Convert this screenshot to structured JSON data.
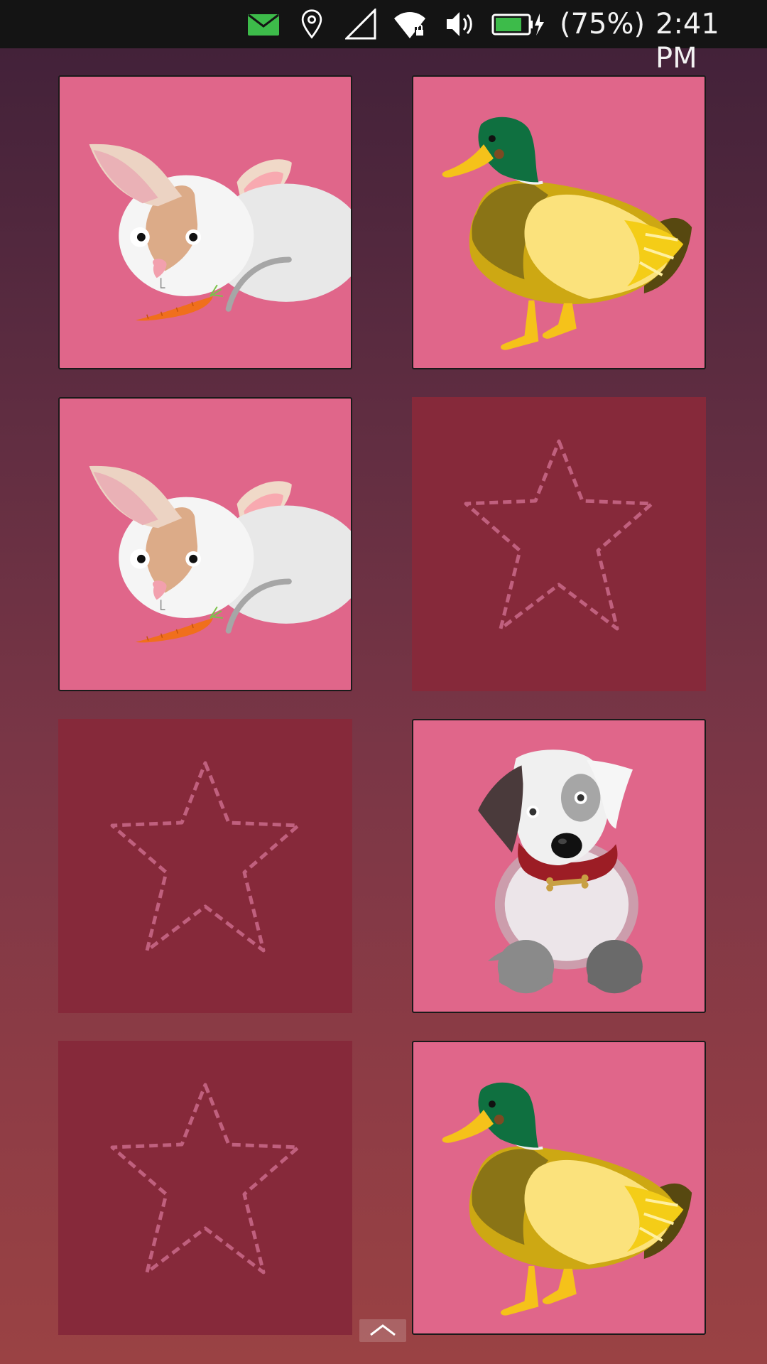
{
  "status_bar": {
    "battery_text": "(75%)",
    "time": "2:41 PM",
    "icons": [
      "mail-icon",
      "location-icon",
      "signal-icon",
      "wifi-lock-icon",
      "volume-icon",
      "battery-charging-icon"
    ],
    "mail_color": "#3dbb4a"
  },
  "board": {
    "columns": 2,
    "rows": 4,
    "cards": [
      {
        "animal": "rabbit",
        "state": "face-up"
      },
      {
        "animal": "duck",
        "state": "face-up"
      },
      {
        "animal": "rabbit",
        "state": "face-up"
      },
      {
        "animal": "hidden",
        "state": "face-down"
      },
      {
        "animal": "hidden",
        "state": "face-down"
      },
      {
        "animal": "dog",
        "state": "face-up"
      },
      {
        "animal": "hidden",
        "state": "face-down"
      },
      {
        "animal": "duck",
        "state": "face-up"
      }
    ],
    "colors": {
      "face_up_bg": "#e0668a",
      "face_down_bg": "#86293a",
      "star_outline": "#c0607e"
    }
  },
  "scroll_button": {
    "icon": "chevron-up-icon"
  }
}
